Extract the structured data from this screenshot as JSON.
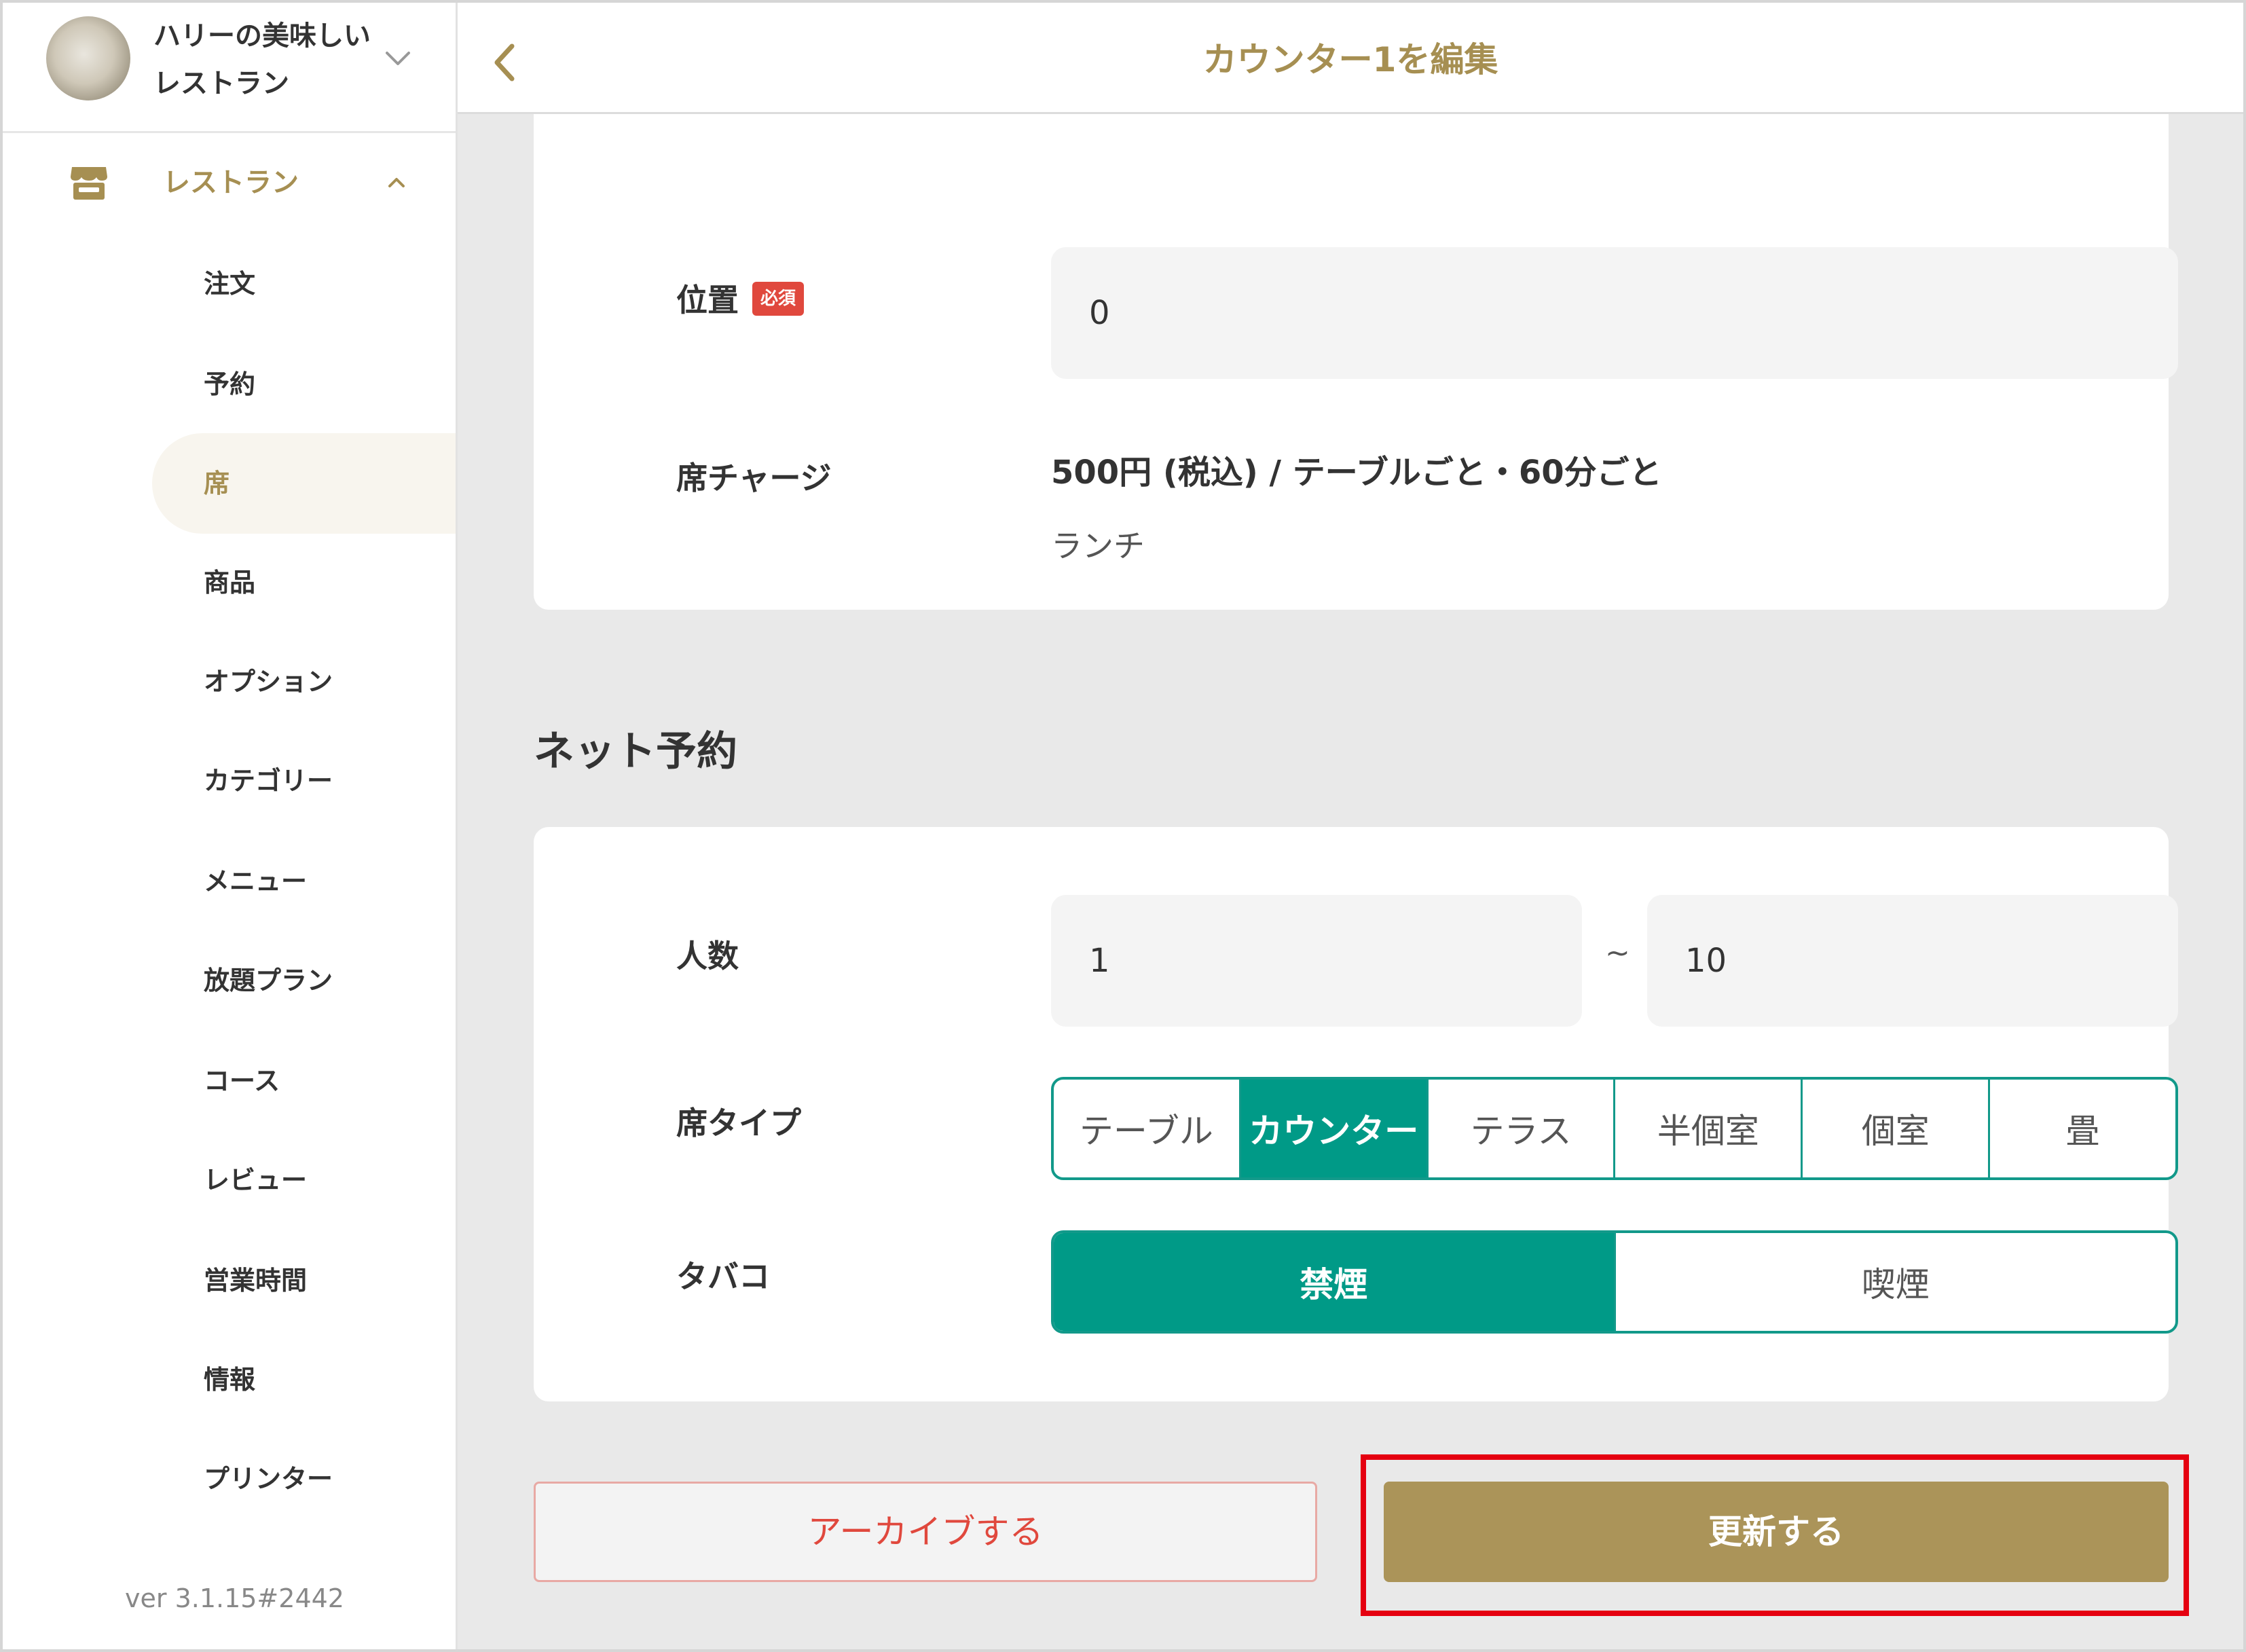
{
  "sidebar": {
    "restaurant_name_line1": "ハリーの美味しい",
    "restaurant_name_line2": "レストラン",
    "section_label": "レストラン",
    "items": [
      {
        "label": "注文"
      },
      {
        "label": "予約"
      },
      {
        "label": "席",
        "active": true
      },
      {
        "label": "商品"
      },
      {
        "label": "オプション"
      },
      {
        "label": "カテゴリー"
      },
      {
        "label": "メニュー"
      },
      {
        "label": "放題プラン"
      },
      {
        "label": "コース"
      },
      {
        "label": "レビュー"
      },
      {
        "label": "営業時間"
      },
      {
        "label": "情報"
      },
      {
        "label": "プリンター"
      }
    ],
    "version": "ver 3.1.15#2442"
  },
  "header": {
    "title": "カウンター1を編集"
  },
  "form": {
    "position_label": "位置",
    "required_badge": "必須",
    "position_value": "0",
    "seat_charge_label": "席チャージ",
    "seat_charge_value": "500円 (税込) / テーブルごと・60分ごと",
    "seat_charge_sub": "ランチ"
  },
  "net_reservation": {
    "heading": "ネット予約",
    "people_label": "人数",
    "people_min": "1",
    "people_separator": "~",
    "people_max": "10",
    "seat_type_label": "席タイプ",
    "seat_types": [
      "テーブル",
      "カウンター",
      "テラス",
      "半個室",
      "個室",
      "畳"
    ],
    "seat_type_selected": "カウンター",
    "tobacco_label": "タバコ",
    "tobacco_options": [
      "禁煙",
      "喫煙"
    ],
    "tobacco_selected": "禁煙"
  },
  "actions": {
    "archive_label": "アーカイブする",
    "update_label": "更新する"
  },
  "colors": {
    "accent_gold": "#a68f52",
    "teal": "#009a87",
    "danger_red": "#e0483d",
    "highlight_red": "#e50010"
  }
}
